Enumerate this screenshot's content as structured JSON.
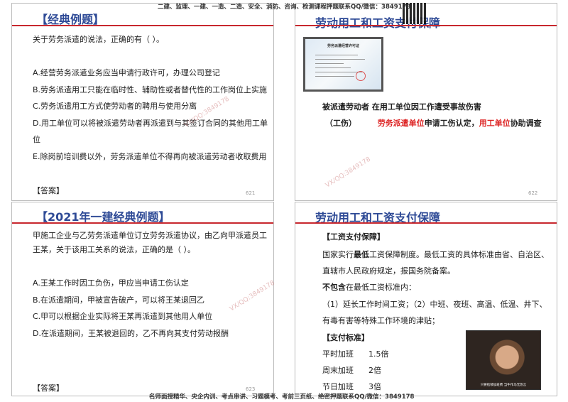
{
  "banner_top": "二建、监理、一建、一造、二造、安全、消防、咨询、检测课程押题联系QQ/微信：3849178",
  "banner_bottom": "名师面授精华、央企内训、考点串讲、习题模考、考前三页纸、绝密押题联系QQ/微信：3849178",
  "watermark": "VX/QQ:3849178",
  "slide1": {
    "title": "【经典例题】",
    "question": "关于劳务派遣的说法，正确的有（ ）。",
    "options": [
      "A.经营劳务派遣业务应当申请行政许可，办理公司登记",
      "B.劳务派遣用工只能在临时性、辅助性或者替代性的工作岗位上实施",
      "C.劳务派遣用工方式使劳动者的聘用与使用分离",
      "D.用工单位可以将被派遣劳动者再派遣到与其签订合同的其他用工单",
      "位",
      "E.除岗前培训费以外，劳务派遣单位不得再向被派遣劳动者收取费用"
    ],
    "answer": "【答案】",
    "page": "621"
  },
  "slide2": {
    "title": "劳动用工和工资支付保障",
    "cert_title": "劳务派遣经营许可证",
    "line1": "被派遣劳动者 在用工单位因工作遭受事故伤害",
    "tag": "（工伤）",
    "red1": "劳务派遣单位",
    "mid": "申请工伤认定，",
    "red2": "用工单位",
    "end": "协助调查",
    "page": "622"
  },
  "slide3": {
    "title": "【2021年一建经典例题】",
    "question": [
      "甲施工企业与乙劳务派遣单位订立劳务派遣协议，由乙向甲派遣员工",
      "王某，关于该用工关系的说法，正确的是（ ）。"
    ],
    "options": [
      "A.王某工作时因工负伤，甲应当申请工伤认定",
      "B.在派遣期间，甲被宣告破产，可以将王某退回乙",
      "C.甲可以根据企业实际将王某再派遣到其他用人单位",
      "D.在派遣期间，王某被退回的，乙不再向其支付劳动报酬"
    ],
    "answer": "【答案】",
    "page": "623"
  },
  "slide4": {
    "title": "劳动用工和工资支付保障",
    "h1": "【工资支付保障】",
    "p1a": "国家实行",
    "p1b": "最低",
    "p1c": "工资保障制度。最低工资的具体标准由省、自治区、",
    "p2": "直辖市人民政府规定，报国务院备案。",
    "p3a": "不包含",
    "p3b": "在最低工资标准内：",
    "p4": "（1）延长工作时间工资；（2）中班、夜班、高温、低温、井下、",
    "p5": "有毒有害等特殊工作环境的津贴；",
    "h2": "【支付标准】",
    "rates": [
      {
        "k": "平时加班",
        "v": "1.5倍"
      },
      {
        "k": "周末加班",
        "v": "2倍"
      },
      {
        "k": "节日加班",
        "v": "3倍"
      }
    ],
    "photo_caption": "只要给够加班费 当牛作马无怨言"
  }
}
